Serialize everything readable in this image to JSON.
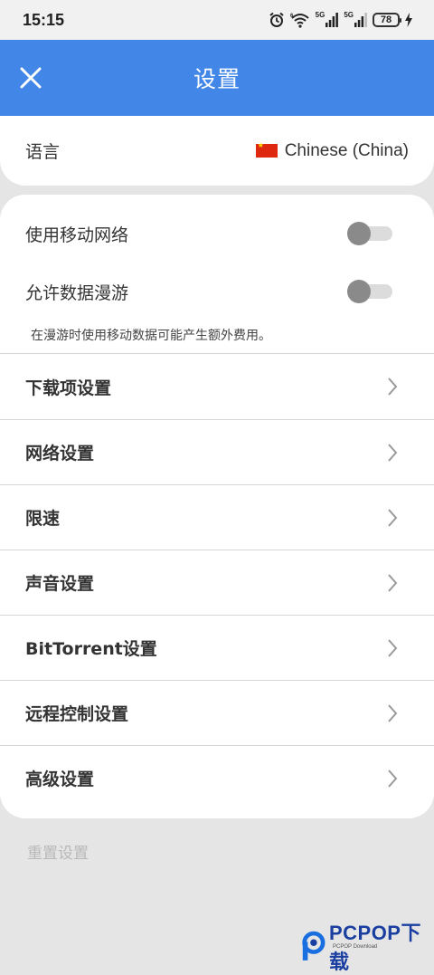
{
  "status_bar": {
    "time": "15:15",
    "signal_1_label": "5G",
    "signal_2_label": "5G",
    "battery": "78",
    "icons": [
      "alarm-icon",
      "wifi-icon",
      "signal-icon",
      "signal-icon",
      "battery-icon",
      "charging-icon"
    ]
  },
  "header": {
    "title": "设置",
    "close_icon": "close-icon"
  },
  "language": {
    "label": "语言",
    "value": "Chinese (China)",
    "flag_icon": "china-flag-icon"
  },
  "toggles": [
    {
      "label": "使用移动网络",
      "checked": false
    },
    {
      "label": "允许数据漫游",
      "checked": false
    }
  ],
  "roaming_hint": "在漫游时使用移动数据可能产生额外费用。",
  "nav_items": [
    {
      "label": "下载项设置"
    },
    {
      "label": "网络设置"
    },
    {
      "label": "限速"
    },
    {
      "label": "声音设置"
    },
    {
      "label": "BitTorrent设置"
    },
    {
      "label": "远程控制设置"
    },
    {
      "label": "高级设置"
    }
  ],
  "reset_label": "重置设置",
  "watermark": {
    "brand": "PCPOP下载",
    "sub": "PCPOP Download"
  },
  "colors": {
    "header": "#4287e8",
    "background": "#e5e5e5",
    "card": "#ffffff",
    "toggle_knob_off": "#8a8a8a",
    "toggle_track_off": "#dcdcdc"
  }
}
